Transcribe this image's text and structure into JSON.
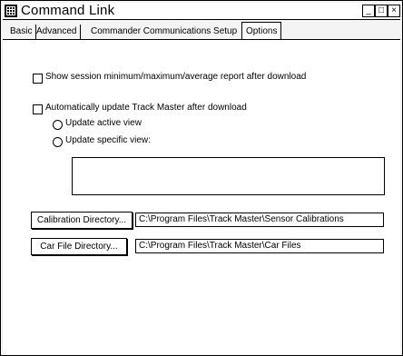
{
  "window": {
    "title": "Command Link"
  },
  "titlebar": {
    "minimize": "_",
    "maximize": "□",
    "close": "×"
  },
  "tabs": [
    "Basic",
    "Advanced",
    "Commander Communications Setup",
    "Options"
  ],
  "options": {
    "show_report": "Show session minimum/maximum/average report  after download",
    "auto_update": "Automatically update Track Master after download",
    "update_active": "Update active view",
    "update_specific": "Update specific view:",
    "calibration_button": "Calibration Directory...",
    "calibration_path": "C:\\Program Files\\Track Master\\Sensor Calibrations",
    "carfile_button": "Car File Directory...",
    "carfile_path": "C:\\Program Files\\Track Master\\Car Files"
  }
}
